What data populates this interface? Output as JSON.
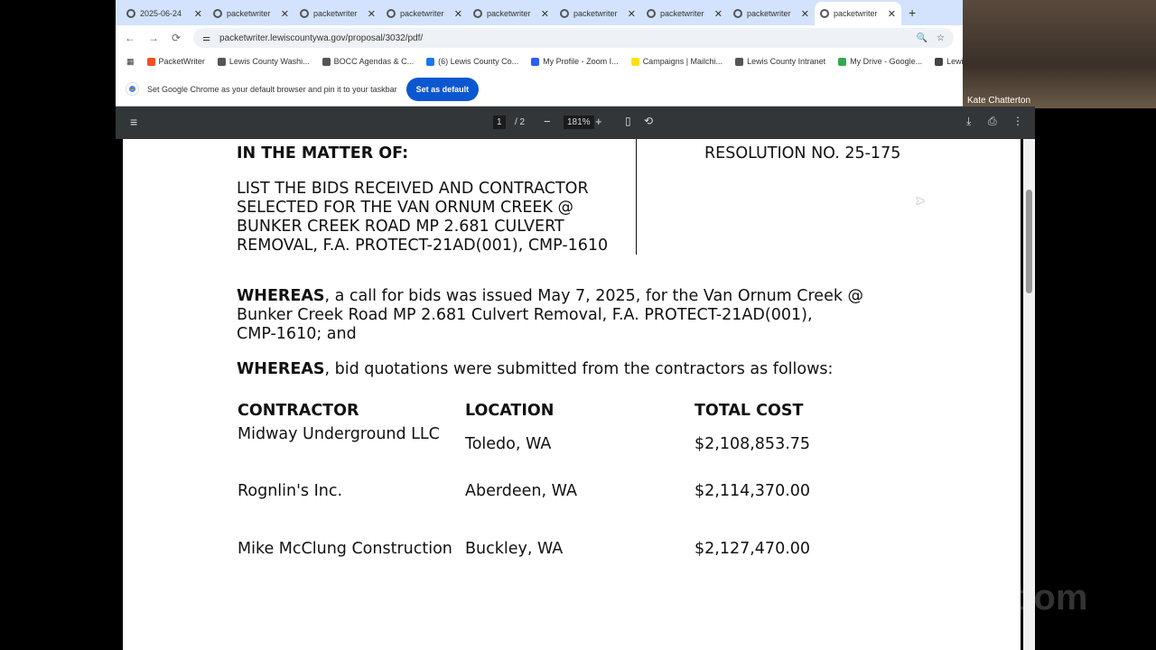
{
  "tabs": [
    "2025-06-24",
    "packetwriter",
    "packetwriter",
    "packetwriter",
    "packetwriter",
    "packetwriter",
    "packetwriter",
    "packetwriter",
    "packetwriter"
  ],
  "address": {
    "url": "packetwriter.lewiscountywa.gov/proposal/3032/pdf/"
  },
  "bookmarks": [
    "PacketWriter",
    "Lewis County Washi...",
    "BOCC Agendas & C...",
    "(6) Lewis County Co...",
    "My Profile - Zoom I...",
    "Campaigns | Mailchi...",
    "Lewis County Intranet",
    "My Drive - Google...",
    "Lewis County ownCl..."
  ],
  "notice": {
    "text": "Set Google Chrome as your default browser and pin it to your taskbar",
    "button": "Set as default"
  },
  "video": {
    "name": "Kate Chatterton",
    "watermark": "zoom"
  },
  "pdf": {
    "page": "1",
    "pages": "/ 2",
    "zoom": "181%"
  },
  "doc": {
    "matter": "IN THE MATTER OF:",
    "resolution": "RESOLUTION NO. 25-175",
    "subject": [
      "LIST THE BIDS RECEIVED AND CONTRACTOR",
      "SELECTED FOR THE VAN ORNUM CREEK @",
      "BUNKER CREEK ROAD MP 2.681 CULVERT",
      "REMOVAL, F.A. PROTECT-21AD(001), CMP-1610"
    ],
    "whereas": "WHEREAS",
    "w1": [
      ", a call for bids was issued May 7, 2025, for the Van Ornum Creek @",
      "Bunker Creek Road MP 2.681 Culvert Removal, F.A. PROTECT-21AD(001),",
      "CMP-1610; and"
    ],
    "w2": ", bid quotations were submitted from the contractors as follows:",
    "headers": [
      "CONTRACTOR",
      "LOCATION",
      "TOTAL COST"
    ],
    "rows": [
      [
        "Midway Underground LLC",
        "Toledo, WA",
        "$2,108,853.75"
      ],
      [
        "Rognlin's Inc.",
        "Aberdeen, WA",
        "$2,114,370.00"
      ],
      [
        "Mike McClung Construction",
        "Buckley, WA",
        "$2,127,470.00"
      ]
    ]
  }
}
